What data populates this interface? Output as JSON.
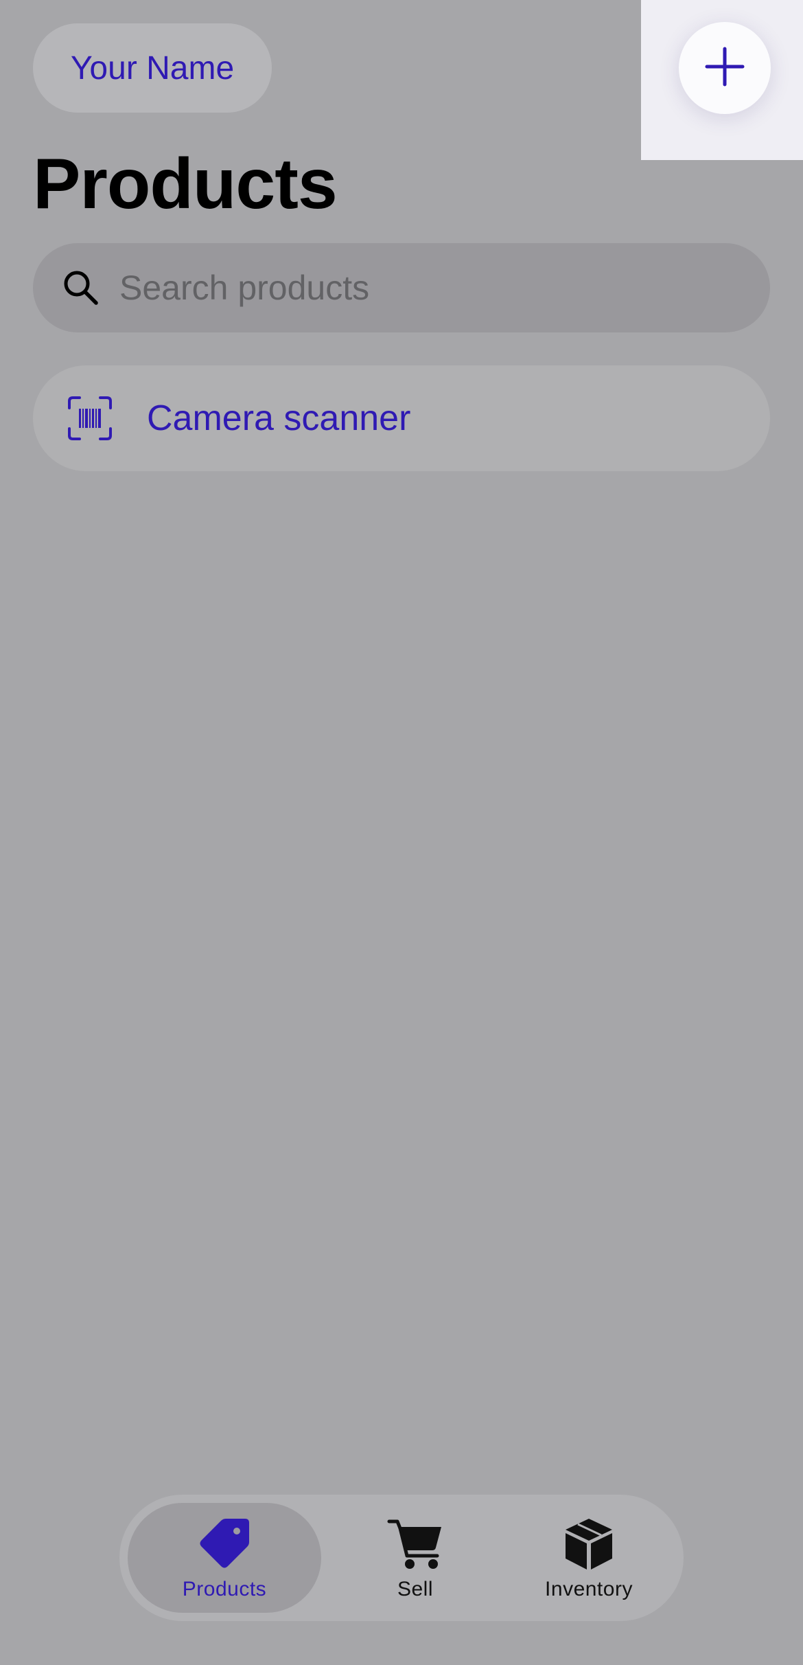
{
  "header": {
    "account_label": "Your Name",
    "add_icon": "plus-icon",
    "accent_color": "#2f1ab3"
  },
  "page": {
    "title": "Products"
  },
  "search": {
    "placeholder": "Search products",
    "value": "",
    "icon": "search-icon"
  },
  "scanner": {
    "label": "Camera scanner",
    "icon": "barcode-scanner-icon"
  },
  "tab_bar": {
    "selected": "Products",
    "tabs": [
      {
        "label": "Products",
        "icon": "tag-icon"
      },
      {
        "label": "Sell",
        "icon": "cart-icon"
      },
      {
        "label": "Inventory",
        "icon": "box-icon"
      }
    ]
  }
}
